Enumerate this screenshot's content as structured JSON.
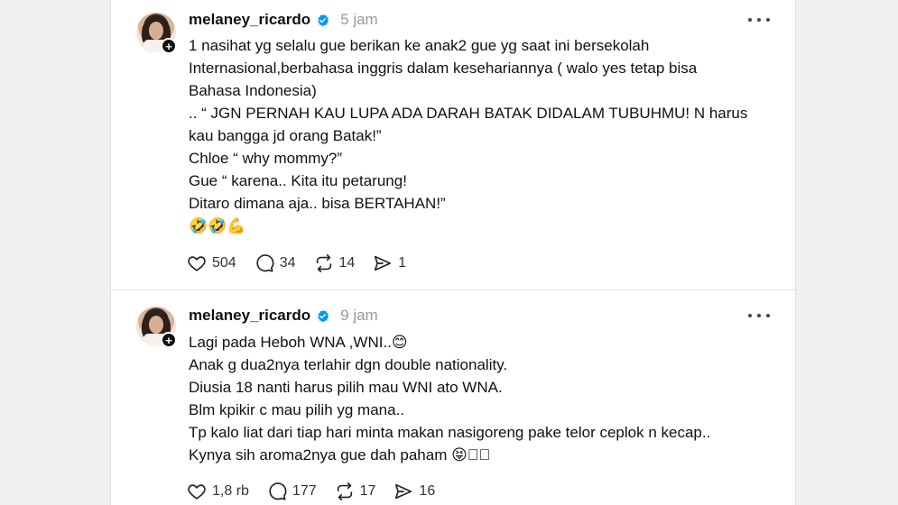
{
  "posts": [
    {
      "username": "melaney_ricardo",
      "time": "5 jam",
      "lines": [
        "1 nasihat yg selalu gue berikan ke anak2 gue yg saat ini bersekolah",
        "Internasional,berbahasa inggris dalam kesehariannya ( walo yes tetap bisa",
        "Bahasa Indonesia)",
        ".. “ JGN PERNAH KAU LUPA ADA DARAH BATAK DIDALAM TUBUHMU! N harus",
        "kau bangga jd orang Batak!”",
        "Chloe “ why mommy?”",
        "Gue “ karena.. Kita itu petarung!",
        "Ditaro dimana aja.. bisa BERTAHAN!”"
      ],
      "emoji_line": "🤣🤣💪",
      "likes": "504",
      "replies": "34",
      "reposts": "14",
      "shares": "1"
    },
    {
      "username": "melaney_ricardo",
      "time": "9 jam",
      "lines": [
        "Lagi pada Heboh WNA ,WNI..😊",
        "Anak g dua2nya terlahir dgn double nationality.",
        "Diusia 18 nanti harus pilih mau WNI ato WNA.",
        "Blm kpikir c mau pilih yg mana..",
        "Tp kalo liat dari tiap hari minta makan nasigoreng pake telor ceplok n kecap..",
        "Kynya sih aroma2nya gue dah paham 😝􏿾􏿾"
      ],
      "likes": "1,8 rb",
      "replies": "177",
      "reposts": "17",
      "shares": "16"
    }
  ],
  "icons": {
    "like": "heart-icon",
    "reply": "comment-icon",
    "repost": "repost-icon",
    "share": "share-icon",
    "verified": "verified-badge-icon",
    "more": "more-options-icon",
    "follow": "plus-icon"
  },
  "colors": {
    "verified": "#0095f6",
    "time": "#999999",
    "background": "#f0f0f0"
  }
}
